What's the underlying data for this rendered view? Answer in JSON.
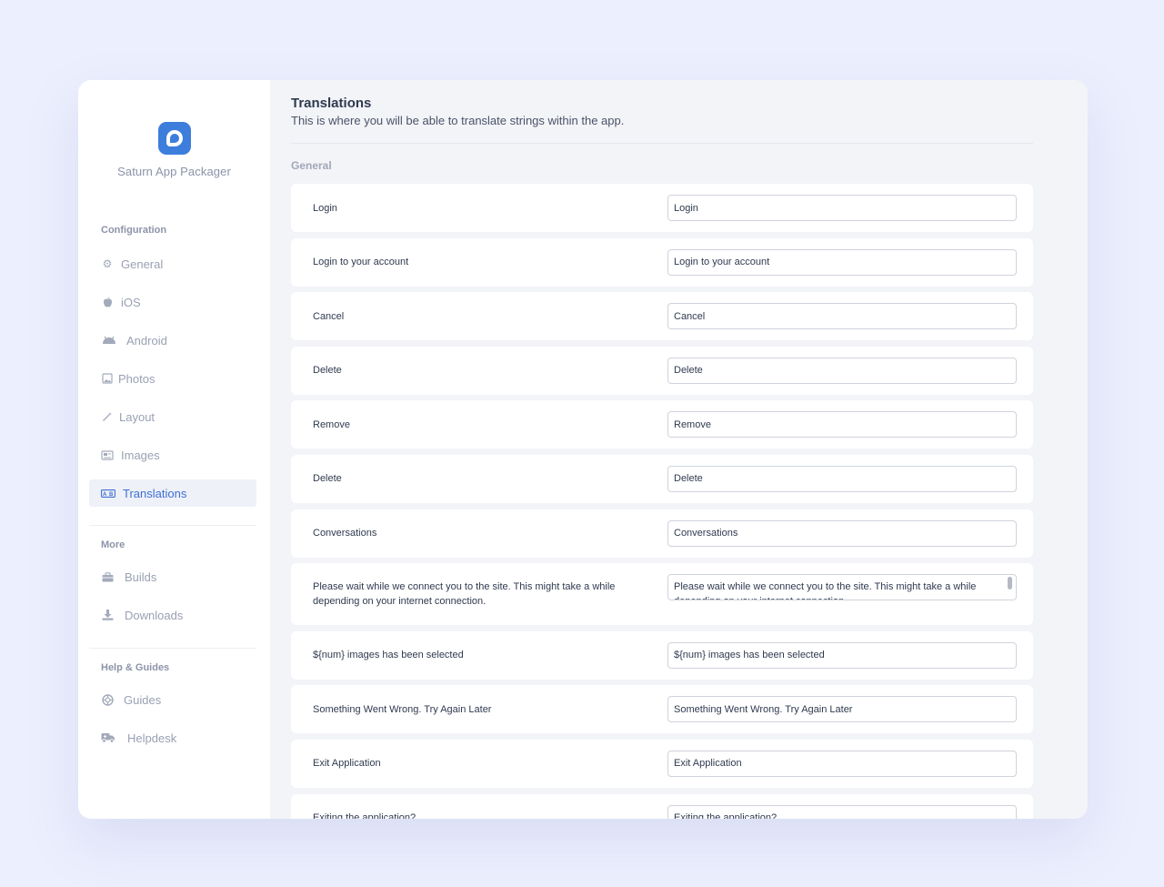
{
  "app": {
    "name": "Saturn App Packager",
    "accent": "#3d7ddc"
  },
  "sidebar": {
    "sections": [
      {
        "heading": "Configuration",
        "items": [
          {
            "label": "General",
            "icon": "gear-icon"
          },
          {
            "label": "iOS",
            "icon": "apple-icon"
          },
          {
            "label": "Android",
            "icon": "android-icon"
          },
          {
            "label": "Photos",
            "icon": "image-icon"
          },
          {
            "label": "Layout",
            "icon": "magic-wand-icon"
          },
          {
            "label": "Images",
            "icon": "gallery-icon"
          },
          {
            "label": "Translations",
            "icon": "translate-icon",
            "active": true
          }
        ]
      },
      {
        "heading": "More",
        "items": [
          {
            "label": "Builds",
            "icon": "toolbox-icon"
          },
          {
            "label": "Downloads",
            "icon": "download-icon"
          }
        ]
      },
      {
        "heading": "Help & Guides",
        "items": [
          {
            "label": "Guides",
            "icon": "lifebuoy-icon"
          },
          {
            "label": "Helpdesk",
            "icon": "truck-icon"
          }
        ]
      }
    ]
  },
  "page": {
    "title": "Translations",
    "subtitle": "This is where you will be able to translate strings within the app.",
    "group": "General"
  },
  "translations": [
    {
      "label": "Login",
      "value": "Login"
    },
    {
      "label": "Login to your account",
      "value": "Login to your account"
    },
    {
      "label": "Cancel",
      "value": "Cancel"
    },
    {
      "label": "Delete",
      "value": "Delete"
    },
    {
      "label": "Remove",
      "value": "Remove"
    },
    {
      "label": "Delete",
      "value": "Delete"
    },
    {
      "label": "Conversations",
      "value": "Conversations"
    },
    {
      "label": "Please wait while we connect you to the site. This might take a while depending on your internet connection.",
      "value": "Please wait while we connect you to the site. This might take a while depending on your internet connection."
    },
    {
      "label": "${num} images has been selected",
      "value": "${num} images has been selected"
    },
    {
      "label": "Something Went Wrong. Try Again Later",
      "value": "Something Went Wrong. Try Again Later"
    },
    {
      "label": "Exit Application",
      "value": "Exit Application"
    },
    {
      "label": "Exiting the application?",
      "value": "Exiting the application?"
    }
  ]
}
